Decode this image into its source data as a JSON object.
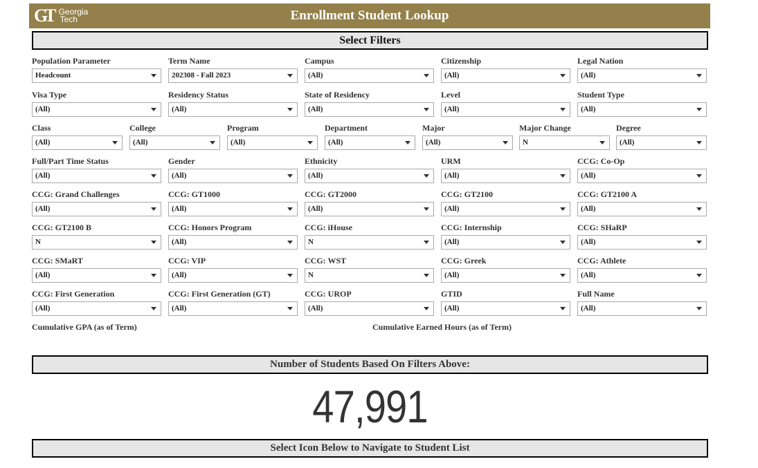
{
  "header": {
    "logo_mark": "GT",
    "logo_line1": "Georgia",
    "logo_line2": "Tech",
    "title": "Enrollment Student Lookup",
    "brand_color": "#94804a"
  },
  "sections": {
    "select_filters": "Select Filters",
    "count_heading": "Number of Students Based On Filters Above:",
    "navigate_heading": "Select Icon Below to Navigate to Student List"
  },
  "filters": [
    {
      "label": "Population Parameter",
      "value": "Headcount"
    },
    {
      "label": "Term Name",
      "value": "202308 - Fall 2023"
    },
    {
      "label": "Campus",
      "value": "(All)"
    },
    {
      "label": "Citizenship",
      "value": "(All)"
    },
    {
      "label": "Legal Nation",
      "value": "(All)"
    },
    {
      "label": "Visa Type",
      "value": "(All)"
    },
    {
      "label": "Residency Status",
      "value": "(All)"
    },
    {
      "label": "State of Residency",
      "value": "(All)"
    },
    {
      "label": "Level",
      "value": "(All)"
    },
    {
      "label": "Student Type",
      "value": "(All)"
    },
    {
      "label": "Class",
      "value": "(All)"
    },
    {
      "label": "College",
      "value": "(All)"
    },
    {
      "label": "Program",
      "value": "(All)"
    },
    {
      "label": "Department",
      "value": "(All)"
    },
    {
      "label": "Major",
      "value": "(All)"
    },
    {
      "label": "Major Change",
      "value": "N"
    },
    {
      "label": "Degree",
      "value": "(All)"
    },
    {
      "label": "Full/Part Time Status",
      "value": "(All)"
    },
    {
      "label": "Gender",
      "value": "(All)"
    },
    {
      "label": "Ethnicity",
      "value": "(All)"
    },
    {
      "label": "URM",
      "value": "(All)"
    },
    {
      "label": "CCG: Co-Op",
      "value": "(All)"
    },
    {
      "label": "CCG: Grand Challenges",
      "value": "(All)"
    },
    {
      "label": "CCG: GT1000",
      "value": "(All)"
    },
    {
      "label": "CCG: GT2000",
      "value": "(All)"
    },
    {
      "label": "CCG: GT2100",
      "value": "(All)"
    },
    {
      "label": "CCG: GT2100 A",
      "value": "(All)"
    },
    {
      "label": "CCG: GT2100 B",
      "value": "N"
    },
    {
      "label": "CCG: Honors Program",
      "value": "(All)"
    },
    {
      "label": "CCG: iHouse",
      "value": "N"
    },
    {
      "label": "CCG: Internship",
      "value": "(All)"
    },
    {
      "label": "CCG: SHaRP",
      "value": "(All)"
    },
    {
      "label": "CCG: SMaRT",
      "value": "(All)"
    },
    {
      "label": "CCG: VIP",
      "value": "(All)"
    },
    {
      "label": "CCG: WST",
      "value": "N"
    },
    {
      "label": "CCG: Greek",
      "value": "(All)"
    },
    {
      "label": "CCG: Athlete",
      "value": "(All)"
    },
    {
      "label": "CCG: First Generation",
      "value": "(All)"
    },
    {
      "label": "CCG: First Generation (GT)",
      "value": "(All)"
    },
    {
      "label": "CCG: UROP",
      "value": "(All)"
    },
    {
      "label": "GTID",
      "value": "(All)"
    },
    {
      "label": "Full Name",
      "value": "(All)"
    }
  ],
  "range_filters": {
    "gpa_label": "Cumulative GPA (as of Term)",
    "hours_label": "Cumulative Earned Hours (as of Term)"
  },
  "student_count": "47,991"
}
